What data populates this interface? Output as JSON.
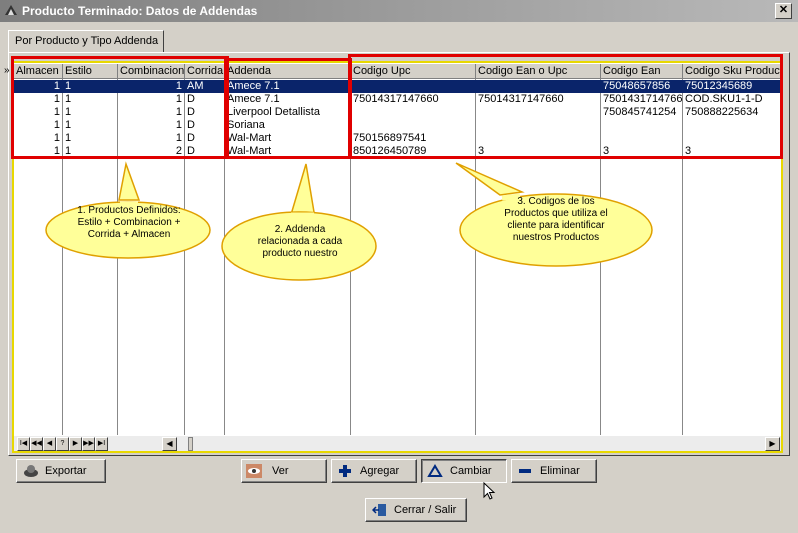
{
  "window": {
    "title": "Producto Terminado: Datos de Addendas",
    "close_label": "✕"
  },
  "tab": {
    "label": "Por Producto y Tipo Addenda"
  },
  "grid": {
    "indicator": "»",
    "columns": [
      "Almacen",
      "Estilo",
      "Combinacion",
      "Corrida",
      "Addenda",
      "Codigo Upc",
      "Codigo Ean o Upc",
      "Codigo Ean",
      "Codigo Sku Producto"
    ],
    "rows": [
      {
        "almacen": "1",
        "estilo": "1",
        "combinacion": "1",
        "corrida": "AM",
        "addenda": "Amece 7.1",
        "upc": "",
        "ean_upc": "",
        "ean": "75048657856",
        "sku": "75012345689",
        "selected": true
      },
      {
        "almacen": "1",
        "estilo": "1",
        "combinacion": "1",
        "corrida": "D",
        "addenda": "Amece 7.1",
        "upc": "75014317147660",
        "ean_upc": "75014317147660",
        "ean": "75014317147660",
        "sku": "COD.SKU1-1-D",
        "selected": false
      },
      {
        "almacen": "1",
        "estilo": "1",
        "combinacion": "1",
        "corrida": "D",
        "addenda": "Liverpool Detallista",
        "upc": "",
        "ean_upc": "",
        "ean": "750845741254",
        "sku": "750888225634",
        "selected": false
      },
      {
        "almacen": "1",
        "estilo": "1",
        "combinacion": "1",
        "corrida": "D",
        "addenda": "Soriana",
        "upc": "",
        "ean_upc": "",
        "ean": "",
        "sku": "",
        "selected": false
      },
      {
        "almacen": "1",
        "estilo": "1",
        "combinacion": "1",
        "corrida": "D",
        "addenda": "Wal-Mart",
        "upc": "750156897541",
        "ean_upc": "",
        "ean": "",
        "sku": "",
        "selected": false
      },
      {
        "almacen": "1",
        "estilo": "1",
        "combinacion": "2",
        "corrida": "D",
        "addenda": "Wal-Mart",
        "upc": "850126450789",
        "ean_upc": "3",
        "ean": "3",
        "sku": "3",
        "selected": false
      }
    ],
    "nav_buttons": [
      "I◀",
      "◀◀",
      "◀",
      "?",
      "▶",
      "▶▶",
      "▶I"
    ]
  },
  "callouts": {
    "c1": [
      "1. Productos Definidos:",
      "Estilo + Combinacion +",
      "Corrida + Almacen"
    ],
    "c2": [
      "2. Addenda",
      "relacionada a cada",
      "producto nuestro"
    ],
    "c3": [
      "3. Codigos de los",
      "Productos que utiliza el",
      "cliente para identificar",
      "nuestros Productos"
    ]
  },
  "buttons": {
    "exportar": "Exportar",
    "ver": "Ver",
    "agregar": "Agregar",
    "cambiar": "Cambiar",
    "eliminar": "Eliminar",
    "cerrar": "Cerrar / Salir"
  },
  "colors": {
    "highlight": "#e00000",
    "callout_fill": "#ffff99",
    "callout_stroke": "#e0a000",
    "selection": "#0a246a"
  }
}
